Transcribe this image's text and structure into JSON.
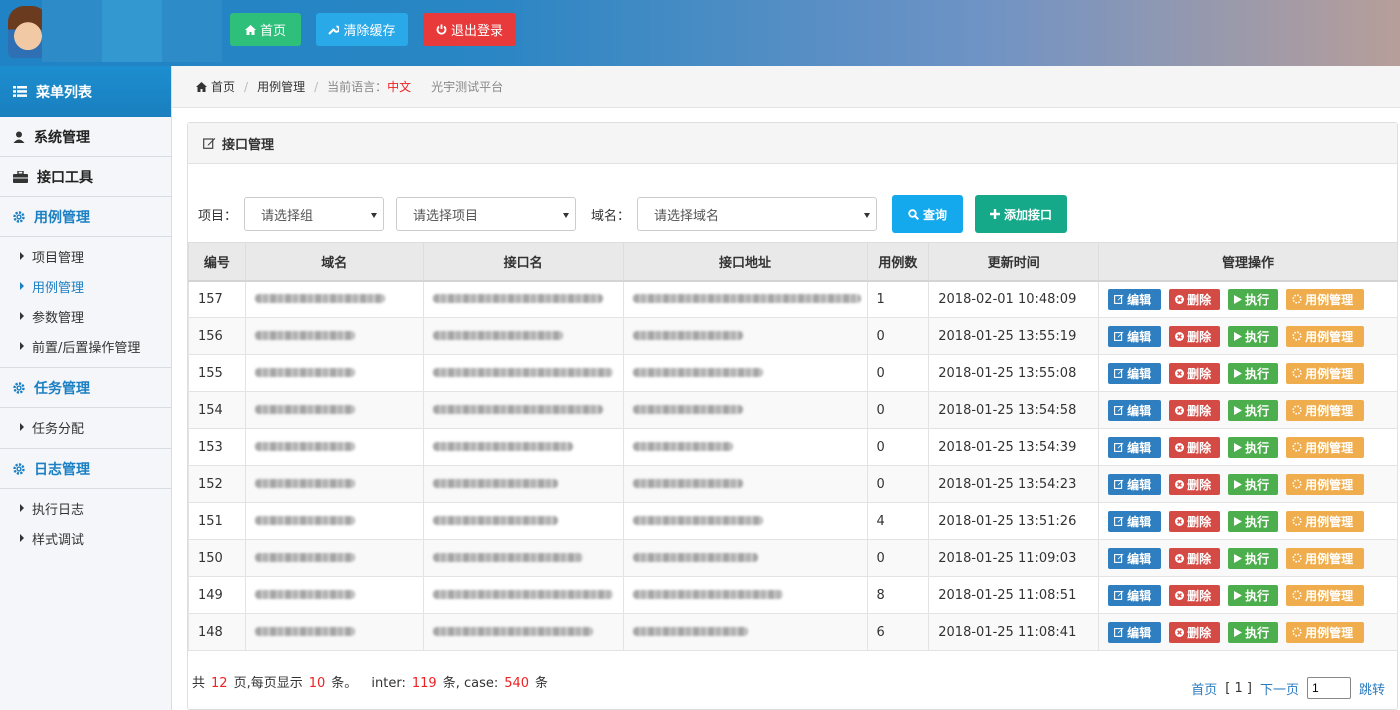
{
  "header": {
    "home_label": "首页",
    "clear_cache_label": "清除缓存",
    "logout_label": "退出登录",
    "logo_colors": [
      "#2d8cc8",
      "#3498d0",
      "#2d8cc8"
    ]
  },
  "sidebar": {
    "title": "菜单列表",
    "sections": [
      {
        "label": "系统管理",
        "icon": "user-icon",
        "items": []
      },
      {
        "label": "接口工具",
        "icon": "briefcase-icon",
        "items": []
      },
      {
        "label": "用例管理",
        "icon": "gear-icon",
        "items": [
          "项目管理",
          "用例管理",
          "参数管理",
          "前置/后置操作管理"
        ]
      },
      {
        "label": "任务管理",
        "icon": "gear-icon",
        "items": [
          "任务分配"
        ]
      },
      {
        "label": "日志管理",
        "icon": "gear-icon",
        "items": [
          "执行日志",
          "样式调试"
        ]
      }
    ]
  },
  "breadcrumb": {
    "home": "首页",
    "section": "用例管理",
    "lang_label": "当前语言：",
    "lang_value": "中文",
    "platform": "光宇测试平台"
  },
  "panel": {
    "title": "接口管理",
    "filters": {
      "project_label": "项目：",
      "group_placeholder": "请选择组",
      "project_placeholder": "请选择项目",
      "domain_label": "域名：",
      "domain_placeholder": "请选择域名",
      "query_label": "查询",
      "add_label": "添加接口"
    },
    "table": {
      "headers": [
        "编号",
        "域名",
        "接口名",
        "接口地址",
        "用例数",
        "更新时间",
        "管理操作"
      ],
      "rows": [
        {
          "id": "157",
          "count": "1",
          "updated": "2018-02-01 10:48:09"
        },
        {
          "id": "156",
          "count": "0",
          "updated": "2018-01-25 13:55:19"
        },
        {
          "id": "155",
          "count": "0",
          "updated": "2018-01-25 13:55:08"
        },
        {
          "id": "154",
          "count": "0",
          "updated": "2018-01-25 13:54:58"
        },
        {
          "id": "153",
          "count": "0",
          "updated": "2018-01-25 13:54:39"
        },
        {
          "id": "152",
          "count": "0",
          "updated": "2018-01-25 13:54:23"
        },
        {
          "id": "151",
          "count": "4",
          "updated": "2018-01-25 13:51:26"
        },
        {
          "id": "150",
          "count": "0",
          "updated": "2018-01-25 11:09:03"
        },
        {
          "id": "149",
          "count": "8",
          "updated": "2018-01-25 11:08:51"
        },
        {
          "id": "148",
          "count": "6",
          "updated": "2018-01-25 11:08:41"
        }
      ],
      "ops": {
        "edit": "编辑",
        "delete": "删除",
        "run": "执行",
        "cases": "用例管理"
      }
    },
    "summary": {
      "prefix": "共",
      "pages": "12",
      "per_page_text": "页,每页显示",
      "per_page": "10",
      "unit": "条。",
      "inter_label": "inter:",
      "inter_count": "119",
      "case_label": "条, case:",
      "case_count": "540",
      "suffix": "条"
    },
    "pager": {
      "first": "首页",
      "current": "[ 1 ]",
      "next": "下一页",
      "jump_value": "1",
      "jump": "跳转"
    }
  }
}
